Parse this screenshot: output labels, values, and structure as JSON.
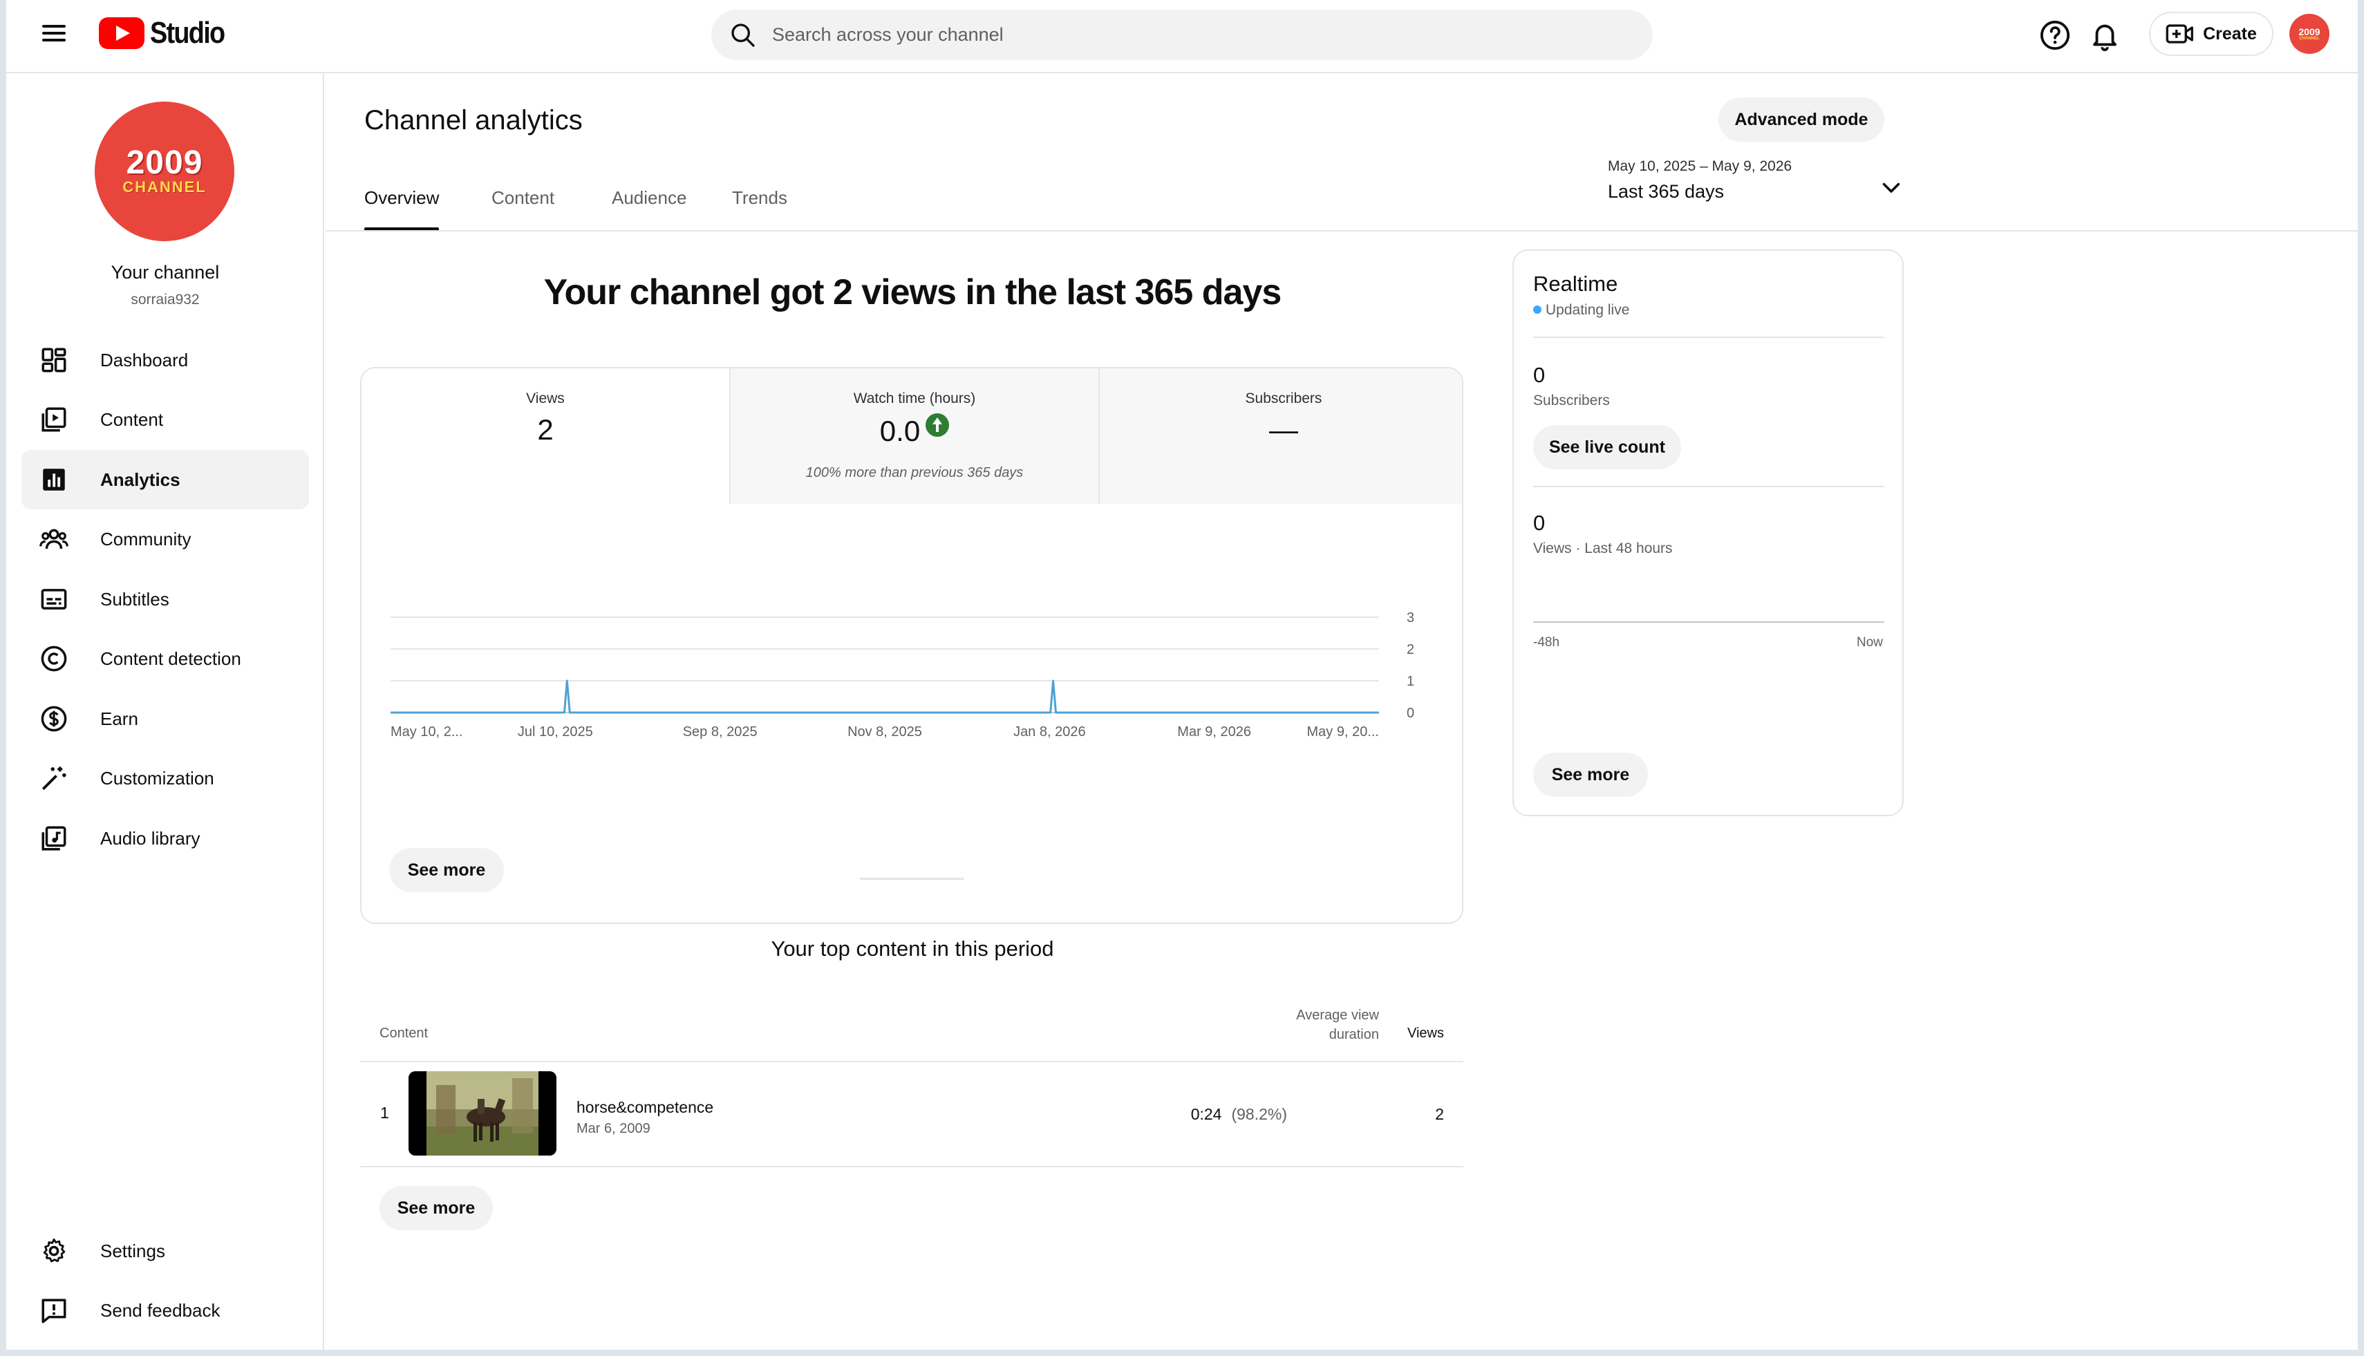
{
  "header": {
    "search_placeholder": "Search across your channel",
    "create_label": "Create",
    "logo_text": "Studio",
    "avatar_text_top": "2009",
    "avatar_text_bottom": "CHANNEL",
    "icons": [
      "menu-icon",
      "youtube-logo-icon",
      "search-icon",
      "help-icon",
      "bell-icon",
      "create-video-icon"
    ]
  },
  "sidebar": {
    "avatar_text_top": "2009",
    "avatar_text_bottom": "CHANNEL",
    "channel_name": "Your channel",
    "channel_handle": "sorraia932",
    "items": [
      {
        "label": "Dashboard",
        "icon": "dashboard-icon"
      },
      {
        "label": "Content",
        "icon": "content-icon"
      },
      {
        "label": "Analytics",
        "icon": "analytics-icon",
        "active": true
      },
      {
        "label": "Community",
        "icon": "community-icon"
      },
      {
        "label": "Subtitles",
        "icon": "subtitles-icon"
      },
      {
        "label": "Content detection",
        "icon": "copyright-icon"
      },
      {
        "label": "Earn",
        "icon": "dollar-icon"
      },
      {
        "label": "Customization",
        "icon": "magic-wand-icon"
      },
      {
        "label": "Audio library",
        "icon": "audio-library-icon"
      }
    ],
    "bottom_items": [
      {
        "label": "Settings",
        "icon": "gear-icon"
      },
      {
        "label": "Send feedback",
        "icon": "feedback-icon"
      }
    ]
  },
  "main": {
    "title": "Channel analytics",
    "advanced_mode_label": "Advanced mode",
    "tabs": [
      {
        "label": "Overview",
        "active": true
      },
      {
        "label": "Content"
      },
      {
        "label": "Audience"
      },
      {
        "label": "Trends"
      }
    ],
    "date_range": {
      "dates": "May 10, 2025 – May 9, 2026",
      "label": "Last 365 days"
    },
    "headline": "Your channel got 2 views in the last 365 days",
    "metrics": [
      {
        "label": "Views",
        "value": "2",
        "note": ""
      },
      {
        "label": "Watch time (hours)",
        "value": "0.0",
        "note": "100% more than previous 365 days",
        "trend": "up"
      },
      {
        "label": "Subscribers",
        "value": "—",
        "note": ""
      }
    ],
    "chart_see_more": "See more",
    "top_content": {
      "title": "Your top content in this period",
      "col_content": "Content",
      "col_avd_line1": "Average view",
      "col_avd_line2": "duration",
      "col_views": "Views",
      "rows": [
        {
          "rank": "1",
          "title": "horse&competence",
          "date": "Mar 6, 2009",
          "avd": "0:24",
          "avd_pct": "(98.2%)",
          "views": "2"
        }
      ],
      "see_more": "See more"
    }
  },
  "realtime": {
    "title": "Realtime",
    "status": "Updating live",
    "subscribers_value": "0",
    "subscribers_label": "Subscribers",
    "see_live_count": "See live count",
    "views_value": "0",
    "views_label": "Views · Last 48 hours",
    "axis_start": "-48h",
    "axis_end": "Now",
    "see_more": "See more",
    "colors": {
      "live_dot": "#3ea6ff"
    }
  },
  "chart_data": {
    "type": "line",
    "title": "",
    "xlabel": "",
    "ylabel": "",
    "x_tick_labels": [
      "May 10, 2...",
      "Jul 10, 2025",
      "Sep 8, 2025",
      "Nov 8, 2025",
      "Jan 8, 2026",
      "Mar 9, 2026",
      "May 9, 20..."
    ],
    "y_ticks": [
      0,
      1,
      2,
      3
    ],
    "ylim": [
      0,
      3
    ],
    "x_start": "2025-05-10",
    "x_end": "2026-05-09",
    "series": [
      {
        "name": "",
        "color": "#4da3d4",
        "points": [
          {
            "x": "2025-05-10",
            "y": 0
          },
          {
            "x": "2025-07-13",
            "y": 0
          },
          {
            "x": "2025-07-14",
            "y": 1
          },
          {
            "x": "2025-07-15",
            "y": 0
          },
          {
            "x": "2026-01-08",
            "y": 0
          },
          {
            "x": "2026-01-09",
            "y": 1
          },
          {
            "x": "2026-01-10",
            "y": 0
          },
          {
            "x": "2026-05-09",
            "y": 0
          }
        ]
      }
    ],
    "grid": true,
    "y_axis_side": "right"
  }
}
